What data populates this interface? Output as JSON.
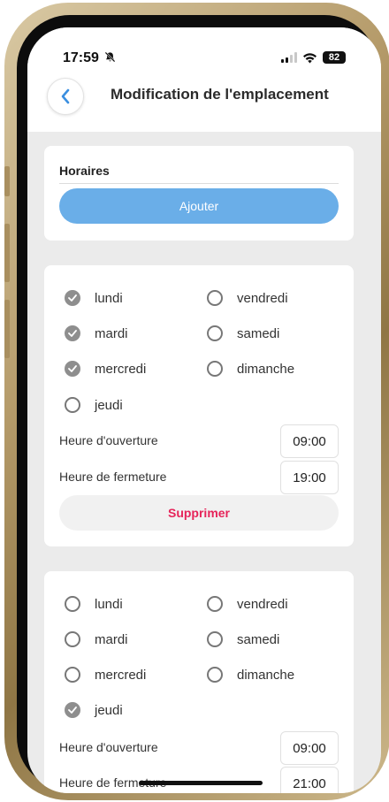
{
  "status_bar": {
    "time": "17:59",
    "battery": "82"
  },
  "header": {
    "title": "Modification de l'emplacement"
  },
  "horaires": {
    "title": "Horaires",
    "add_label": "Ajouter"
  },
  "slots": [
    {
      "days": [
        {
          "label": "lundi",
          "checked": true
        },
        {
          "label": "mardi",
          "checked": true
        },
        {
          "label": "mercredi",
          "checked": true
        },
        {
          "label": "jeudi",
          "checked": false
        },
        {
          "label": "vendredi",
          "checked": false
        },
        {
          "label": "samedi",
          "checked": false
        },
        {
          "label": "dimanche",
          "checked": false
        }
      ],
      "open_label": "Heure d'ouverture",
      "open_time": "09:00",
      "close_label": "Heure de fermeture",
      "close_time": "19:00",
      "delete_label": "Supprimer"
    },
    {
      "days": [
        {
          "label": "lundi",
          "checked": false
        },
        {
          "label": "mardi",
          "checked": false
        },
        {
          "label": "mercredi",
          "checked": false
        },
        {
          "label": "jeudi",
          "checked": true
        },
        {
          "label": "vendredi",
          "checked": false
        },
        {
          "label": "samedi",
          "checked": false
        },
        {
          "label": "dimanche",
          "checked": false
        }
      ],
      "open_label": "Heure d'ouverture",
      "open_time": "09:00",
      "close_label": "Heure de fermeture",
      "close_time": "21:00"
    }
  ],
  "icons": {
    "back": "chevron-left-icon",
    "mute": "bell-slash-icon",
    "signal": "cellular-signal-icon",
    "wifi": "wifi-icon",
    "battery": "battery-icon",
    "check": "check-icon"
  },
  "colors": {
    "accent": "#6aaee8",
    "danger": "#e6245a",
    "checked": "#8e8e8e",
    "background": "#ebebeb"
  }
}
